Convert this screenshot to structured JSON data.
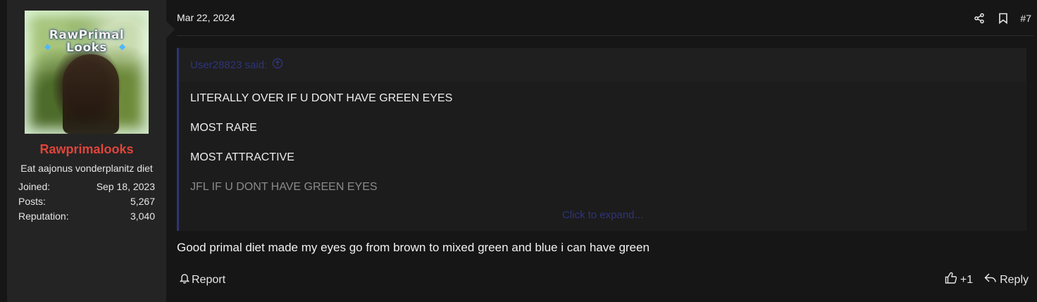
{
  "user": {
    "avatar_text_line1": "RawPrimal",
    "avatar_text_line2": "Looks",
    "username": "Rawprimalooks",
    "title": "Eat aajonus vonderplanitz diet",
    "stats": [
      {
        "label": "Joined:",
        "value": "Sep 18, 2023"
      },
      {
        "label": "Posts:",
        "value": "5,267"
      },
      {
        "label": "Reputation:",
        "value": "3,040"
      }
    ]
  },
  "post": {
    "date": "Mar 22, 2024",
    "number": "#7",
    "quote": {
      "author_line": "User28823 said:",
      "lines": [
        "LITERALLY OVER IF U DONT HAVE GREEN EYES",
        "MOST RARE",
        "MOST ATTRACTIVE",
        "JFL IF U DONT HAVE GREEN EYES"
      ],
      "expand_label": "Click to expand..."
    },
    "message": "Good primal diet made my eyes go from brown to mixed green and blue i can have green"
  },
  "footer": {
    "report_label": "Report",
    "reaction_count": "+1",
    "reply_label": "Reply"
  },
  "icons": {
    "share": "share-icon",
    "bookmark": "bookmark-icon",
    "quote_link": "arrow-up-circle-icon",
    "report": "bell-icon",
    "like": "thumbs-up-icon",
    "reply": "reply-icon"
  },
  "colors": {
    "username": "#e0453a",
    "quote_accent": "#2f3571",
    "background": "#161616"
  }
}
